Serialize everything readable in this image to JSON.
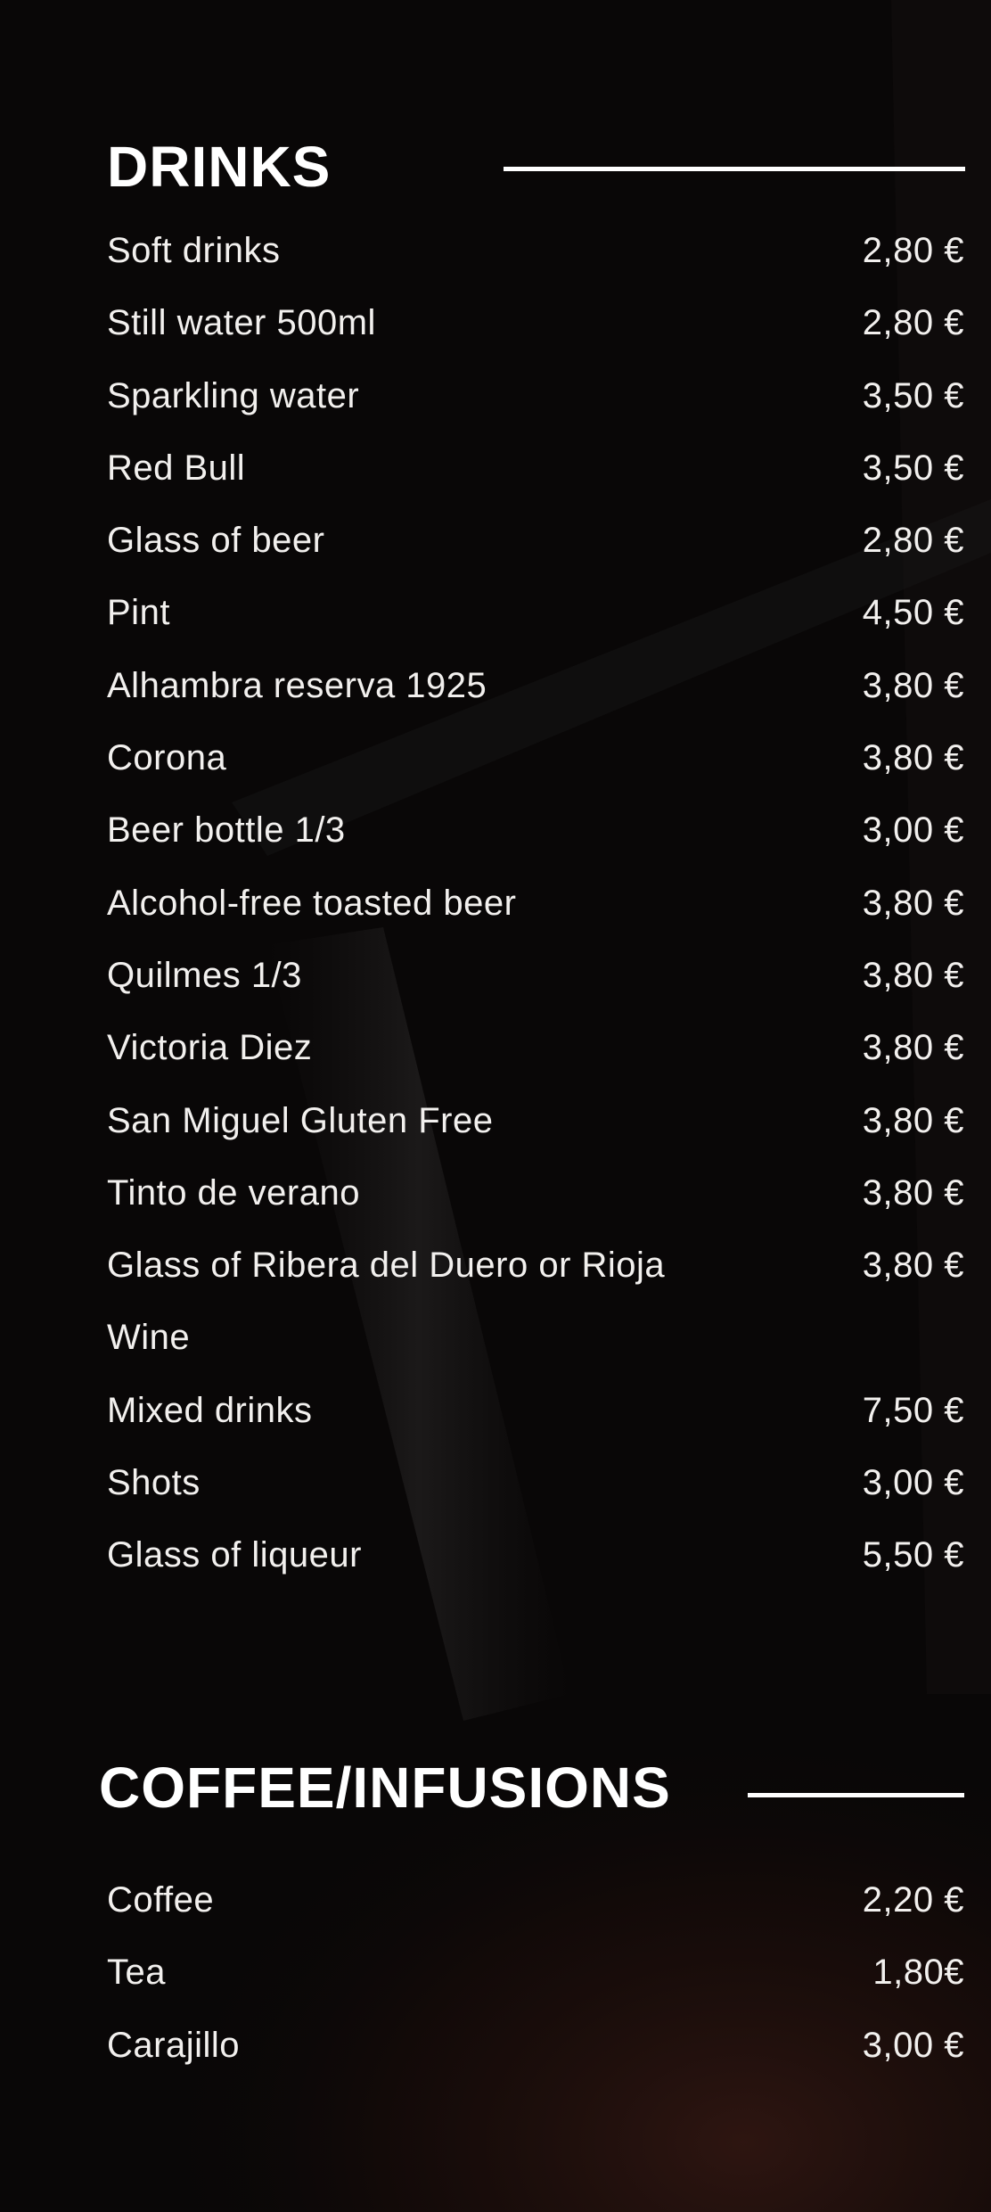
{
  "drinks": {
    "title": "DRINKS",
    "items": [
      {
        "name": "Soft drinks",
        "price": "2,80 €"
      },
      {
        "name": "Still water 500ml",
        "price": "2,80 €"
      },
      {
        "name": "Sparkling water",
        "price": "3,50 €"
      },
      {
        "name": "Red Bull",
        "price": "3,50 €"
      },
      {
        "name": "Glass of beer",
        "price": "2,80 €"
      },
      {
        "name": "Pint",
        "price": "4,50 €"
      },
      {
        "name": "Alhambra reserva 1925",
        "price": "3,80 €"
      },
      {
        "name": "Corona",
        "price": "3,80 €"
      },
      {
        "name": "Beer bottle 1/3",
        "price": "3,00 €"
      },
      {
        "name": "Alcohol-free toasted beer",
        "price": "3,80 €"
      },
      {
        "name": "Quilmes 1/3",
        "price": "3,80 €"
      },
      {
        "name": "Victoria Diez",
        "price": "3,80 €"
      },
      {
        "name": "San Miguel Gluten Free",
        "price": "3,80 €"
      },
      {
        "name": "Tinto de verano",
        "price": "3,80 €"
      },
      {
        "name": "Glass of Ribera del Duero or Rioja",
        "price": "3,80 €"
      },
      {
        "name": "Wine",
        "price": ""
      },
      {
        "name": "Mixed drinks",
        "price": "7,50 €"
      },
      {
        "name": "Shots",
        "price": "3,00 €"
      },
      {
        "name": "Glass of liqueur",
        "price": "5,50 €"
      }
    ]
  },
  "coffee": {
    "title": "COFFEE/INFUSIONS",
    "items": [
      {
        "name": "Coffee",
        "price": "2,20 €"
      },
      {
        "name": "Tea",
        "price": "1,80€"
      },
      {
        "name": "Carajillo",
        "price": "3,00 €"
      }
    ]
  },
  "colors": {
    "background": "#090707",
    "text": "#f2f0ee",
    "heading": "#ffffff",
    "splash": "#3a1a14"
  }
}
